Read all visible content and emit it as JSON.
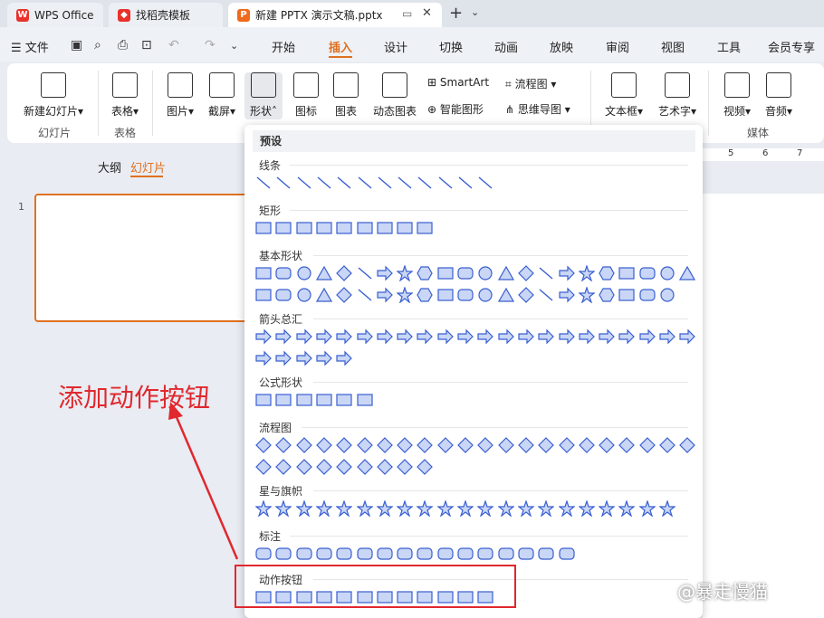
{
  "tabs": [
    {
      "label": "WPS Office",
      "logo": "W"
    },
    {
      "label": "找稻壳模板",
      "logo": "◆"
    },
    {
      "label": "新建 PPTX 演示文稿.pptx",
      "logo": "P"
    }
  ],
  "menu": {
    "file": "文件",
    "items": [
      "开始",
      "插入",
      "设计",
      "切换",
      "动画",
      "放映",
      "审阅",
      "视图",
      "工具",
      "会员专享"
    ]
  },
  "ribbon": {
    "new_slide": "新建幻灯片",
    "group_slides": "幻灯片",
    "table": "表格",
    "group_table": "表格",
    "picture": "图片",
    "screenshot": "截屏",
    "shape": "形状",
    "icon": "图标",
    "chart": "图表",
    "dynamic_chart": "动态图表",
    "smartart": "SmartArt",
    "smart_graphic": "智能图形",
    "flowchart": "流程图",
    "mindmap": "思维导图",
    "textbox": "文本框",
    "wordart": "艺术字",
    "video": "视频",
    "audio": "音频",
    "group_media": "媒体"
  },
  "panel": {
    "outline": "大纲",
    "slides": "幻灯片",
    "slide_number": "1"
  },
  "ruler": {
    "n5": "5",
    "n6": "6",
    "n7": "7"
  },
  "dropdown": {
    "header": "预设",
    "categories": [
      "线条",
      "矩形",
      "基本形状",
      "箭头总汇",
      "公式形状",
      "流程图",
      "星与旗帜",
      "标注",
      "动作按钮"
    ]
  },
  "annotation": "添加动作按钮",
  "watermark": "@暴走慢猫",
  "colors": {
    "accent": "#e07020",
    "annot": "#e0282e",
    "shape_fill": "#c9d6f5",
    "shape_stroke": "#3a5fd0"
  }
}
